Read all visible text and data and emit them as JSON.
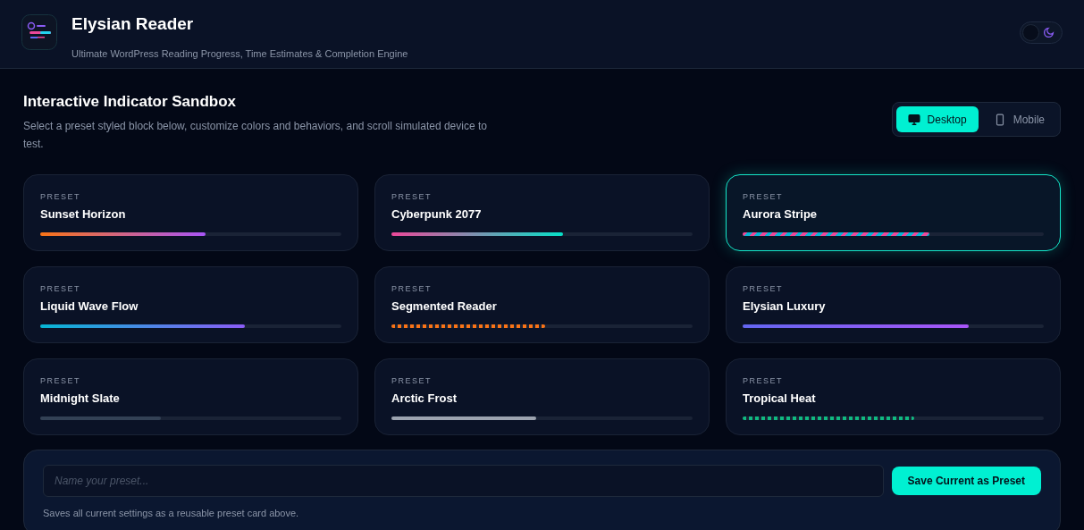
{
  "app": {
    "title": "Elysian Reader",
    "subtitle": "Ultimate WordPress Reading Progress, Time Estimates & Completion Engine",
    "dark_mode": true
  },
  "sandbox": {
    "title": "Interactive Indicator Sandbox",
    "description": "Select a preset styled block below, customize colors and behaviors, and scroll simulated device to test.",
    "devices": [
      {
        "label": "Desktop",
        "kind": "desktop",
        "selected": true
      },
      {
        "label": "Mobile",
        "kind": "mobile",
        "selected": false
      }
    ]
  },
  "presets": [
    {
      "tag": "PRESET",
      "name": "Sunset Horizon",
      "selected": false,
      "kind": "sunset",
      "level": 0.55
    },
    {
      "tag": "PRESET",
      "name": "Cyberpunk 2077",
      "selected": false,
      "kind": "cyberpunk",
      "level": 0.57
    },
    {
      "tag": "PRESET",
      "name": "Aurora Stripe",
      "selected": true,
      "kind": "aurora",
      "level": 0.62
    },
    {
      "tag": "PRESET",
      "name": "Liquid Wave Flow",
      "selected": false,
      "kind": "wave",
      "level": 0.68
    },
    {
      "tag": "PRESET",
      "name": "Segmented Reader",
      "selected": false,
      "kind": "dots",
      "color": "#f97316",
      "level": 0.51
    },
    {
      "tag": "PRESET",
      "name": "Elysian Luxury",
      "selected": false,
      "kind": "luxury",
      "level": 0.75
    },
    {
      "tag": "PRESET",
      "name": "Midnight Slate",
      "selected": false,
      "kind": "solid",
      "color": "#334155",
      "level": 0.4
    },
    {
      "tag": "PRESET",
      "name": "Arctic Frost",
      "selected": false,
      "kind": "solid",
      "color": "#9ca3af",
      "level": 0.48
    },
    {
      "tag": "PRESET",
      "name": "Tropical Heat",
      "selected": false,
      "kind": "dots",
      "color": "#10b981",
      "level": 0.57
    }
  ],
  "save": {
    "placeholder": "Name your preset...",
    "button": "Save Current as Preset",
    "hint": "Saves all current settings as a reusable preset card above."
  }
}
